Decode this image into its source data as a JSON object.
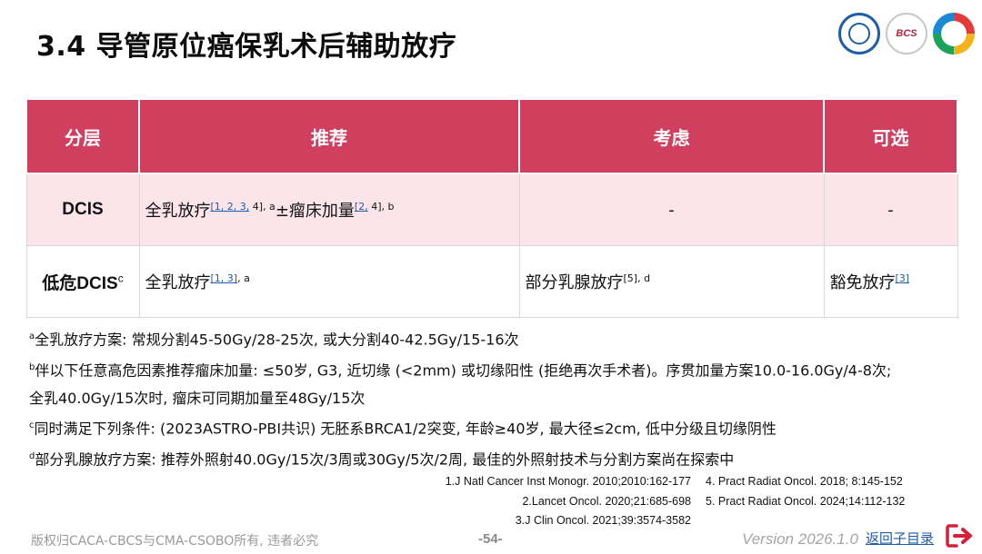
{
  "page": {
    "title": "3.4 导管原位癌保乳术后辅助放疗",
    "watermark": "CACA-CBCS",
    "logo_cbcs_text": "BCS"
  },
  "table": {
    "headers": [
      "分层",
      "推荐",
      "考虑",
      "可选"
    ],
    "rows": [
      {
        "layer": "DCIS",
        "layer_sup": "",
        "rec_text1": "全乳放疗",
        "rec_ref1": "[1, 2, 3,",
        "rec_sup1_rest": " 4], a",
        "rec_text2": "±瘤床加量",
        "rec_ref2": "[2,",
        "rec_sup2_rest": " 4], b",
        "consider": "-",
        "optional": "-"
      },
      {
        "layer": "低危DCIS",
        "layer_sup": "c",
        "rec_text1": "全乳放疗",
        "rec_ref1": "[1, 3]",
        "rec_sup1_rest": ", a",
        "consider_text": "部分乳腺放疗",
        "consider_sup": "[5], d",
        "optional_text": "豁免放疗",
        "optional_ref": "[3]"
      }
    ]
  },
  "notes": [
    {
      "mark": "a",
      "text": "全乳放疗方案: 常规分割45-50Gy/28-25次, 或大分割40-42.5Gy/15-16次"
    },
    {
      "mark": "b",
      "text": "伴以下任意高危因素推荐瘤床加量: ≤50岁, G3, 近切缘 (<2mm) 或切缘阳性 (拒绝再次手术者)。序贯加量方案10.0-16.0Gy/4-8次;"
    },
    {
      "mark": "",
      "text": "全乳40.0Gy/15次时, 瘤床可同期加量至48Gy/15次"
    },
    {
      "mark": "c",
      "text": "同时满足下列条件: (2023ASTRO-PBI共识) 无胚系BRCA1/2突变, 年龄≥40岁, 最大径≤2cm, 低中分级且切缘阴性"
    },
    {
      "mark": "d",
      "text": "部分乳腺放疗方案: 推荐外照射40.0Gy/15次/3周或30Gy/5次/2周, 最佳的外照射技术与分割方案尚在探索中"
    }
  ],
  "references": [
    [
      "1.J Natl Cancer Inst Monogr. 2010;2010:162-177",
      "4. Pract Radiat Oncol. 2018; 8:145-152"
    ],
    [
      "2.Lancet Oncol. 2020;21:685-698",
      "5. Pract Radiat Oncol. 2024;14:112-132"
    ],
    [
      "3.J Clin Oncol. 2021;39:3574-3582",
      ""
    ]
  ],
  "footer": {
    "copyright": "版权归CACA-CBCS与CMA-CSOBO所有, 违者必究",
    "page_number": "-54-",
    "version": "Version 2026.1.0",
    "back_link": "返回子目录"
  },
  "colors": {
    "header_bg": "#d13f5f",
    "row_highlight": "#fbe5ea",
    "link": "#1f5da8",
    "icon_red": "#d6203a"
  },
  "icons": [
    "cancer-association-logo",
    "cbcs-logo",
    "ribbon-logo",
    "return-arrow-icon"
  ]
}
